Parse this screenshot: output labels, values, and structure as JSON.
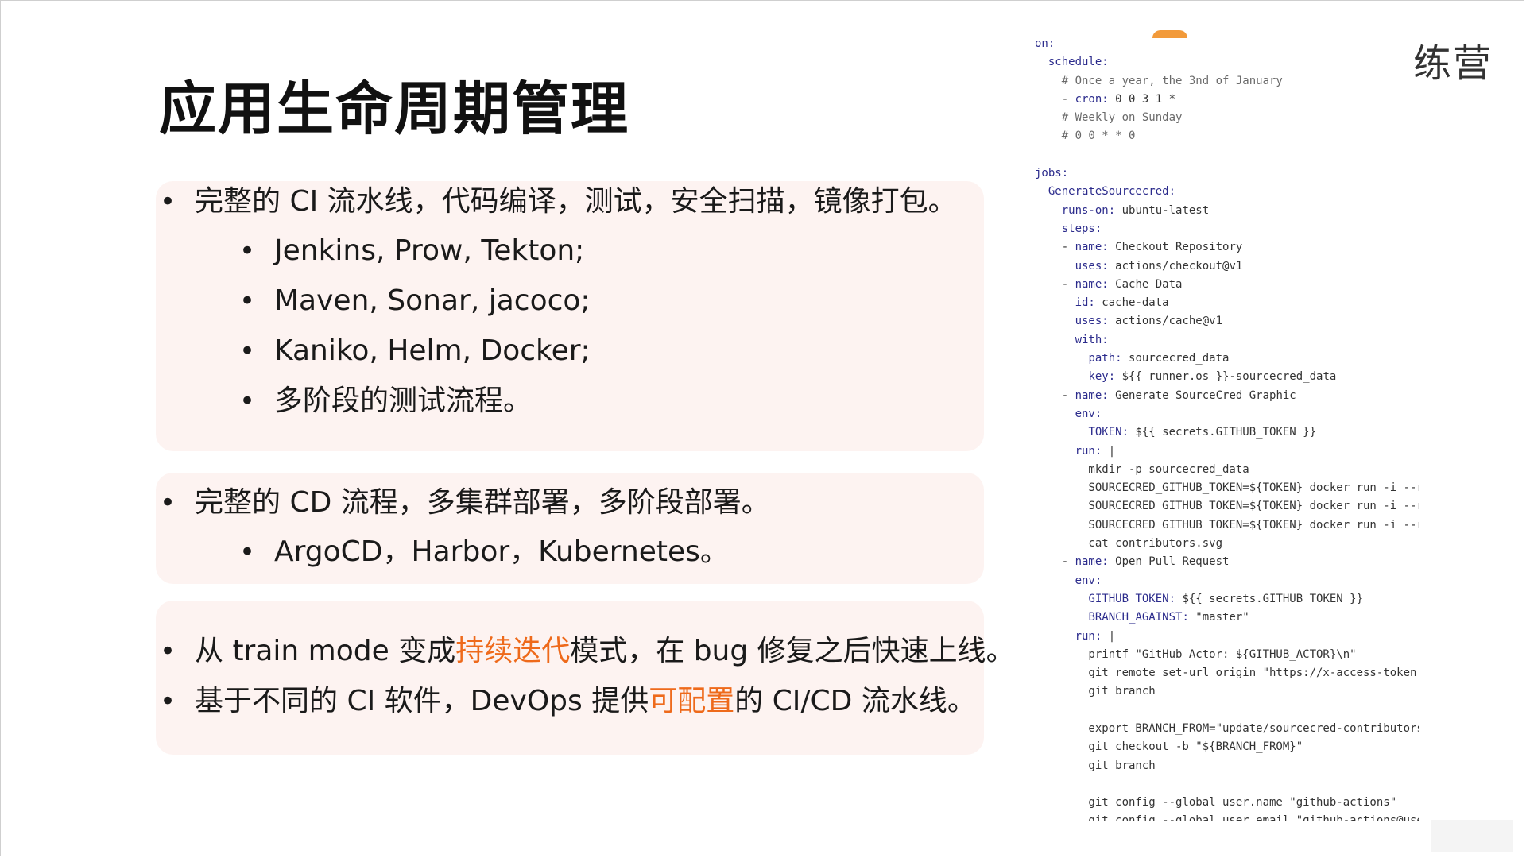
{
  "slide": {
    "title": "应用生命周期管理",
    "brand": "练营"
  },
  "sections": {
    "ci": {
      "bullet": "完整的 CI 流水线，代码编译，测试，安全扫描，镜像打包。",
      "sub": [
        "Jenkins, Prow, Tekton;",
        "Maven, Sonar, jacoco;",
        "Kaniko, Helm, Docker;",
        "多阶段的测试流程。"
      ]
    },
    "cd": {
      "bullet": "完整的 CD 流程，多集群部署，多阶段部署。",
      "sub": [
        "ArgoCD，Harbor，Kubernetes。"
      ]
    },
    "iter": {
      "b1_pre": "从 train mode 变成",
      "b1_hl": "持续迭代",
      "b1_post": "模式，在 bug 修复之后快速上线。",
      "b2_pre": "基于不同的 CI 软件，DevOps 提供",
      "b2_hl": "可配置",
      "b2_post": "的 CI/CD 流水线。"
    }
  },
  "colors": {
    "highlight": "#ee6a1b",
    "card_bg": "#fdf3f1"
  },
  "code_lines": [
    "on:",
    "  schedule:",
    "    # Once a year, the 3nd of January",
    "    - cron: 0 0 3 1 *",
    "    # Weekly on Sunday",
    "    # 0 0 * * 0",
    "",
    "jobs:",
    "  GenerateSourcecred:",
    "    runs-on: ubuntu-latest",
    "    steps:",
    "    - name: Checkout Repository",
    "      uses: actions/checkout@v1",
    "    - name: Cache Data",
    "      id: cache-data",
    "      uses: actions/cache@v1",
    "      with:",
    "        path: sourcecred_data",
    "        key: ${{ runner.os }}-sourcecred_data",
    "    - name: Generate SourceCred Graphic",
    "      env:",
    "        TOKEN: ${{ secrets.GITHUB_TOKEN }}",
    "      run: |",
    "        mkdir -p sourcecred_data",
    "        SOURCECRED_GITHUB_TOKEN=${TOKEN} docker run -i --r",
    "        SOURCECRED_GITHUB_TOKEN=${TOKEN} docker run -i --r",
    "        SOURCECRED_GITHUB_TOKEN=${TOKEN} docker run -i --r",
    "        cat contributors.svg",
    "    - name: Open Pull Request",
    "      env:",
    "        GITHUB_TOKEN: ${{ secrets.GITHUB_TOKEN }}",
    "        BRANCH_AGAINST: \"master\"",
    "      run: |",
    "        printf \"GitHub Actor: ${GITHUB_ACTOR}\\n\"",
    "        git remote set-url origin \"https://x-access-token:",
    "        git branch",
    "",
    "        export BRANCH_FROM=\"update/sourcecred-contributors",
    "        git checkout -b \"${BRANCH_FROM}\"",
    "        git branch",
    "",
    "        git config --global user.name \"github-actions\"",
    "        git config --global user.email \"github-actions@use"
  ]
}
